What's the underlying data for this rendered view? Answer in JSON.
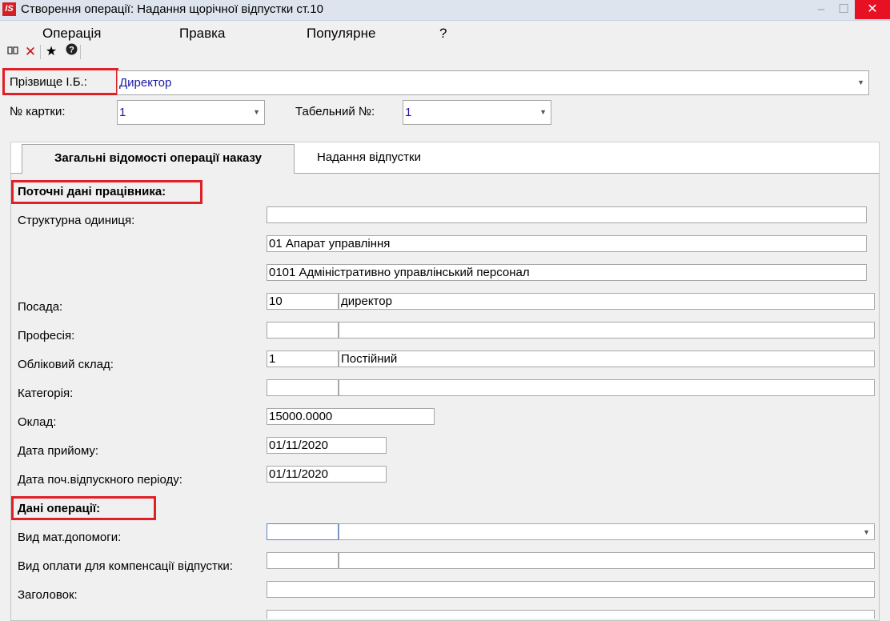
{
  "window": {
    "title": "Створення операції: Надання щорічної відпустки ст.10",
    "app_icon": "IS",
    "minimize": "–",
    "maximize": "☐",
    "close": "✕"
  },
  "menu": [
    "Операція",
    "Правка",
    "Популярне",
    "?"
  ],
  "toolbar": {
    "icons": [
      "book-icon",
      "delete-icon",
      "star-icon",
      "help-icon"
    ],
    "glyphs": [
      "🕮",
      "✕",
      "★",
      "❓"
    ]
  },
  "header": {
    "surname_label": "Прізвище І.Б.:",
    "surname_value": "Директор",
    "card_label": "№ картки:",
    "card_value": "1",
    "tab_number_label": "Табельний №:",
    "tab_number_value": "1"
  },
  "tabs": [
    {
      "label": "Загальні відомості операції наказу",
      "active": true
    },
    {
      "label": "Надання відпустки",
      "active": false
    }
  ],
  "current_data": {
    "section_title": "Поточні дані працівника:",
    "struct_unit_label": "Структурна одиниця:",
    "struct_unit_lines": [
      "",
      "01 Апарат управління",
      "0101 Адміністративно управлінський персонал"
    ],
    "position_label": "Посада:",
    "position_code": "10",
    "position_name": "директор",
    "profession_label": "Професія:",
    "profession_code": "",
    "profession_name": "",
    "staff_label": "Обліковий склад:",
    "staff_code": "1",
    "staff_name": "Постійний",
    "category_label": "Категорія:",
    "category_code": "",
    "category_name": "",
    "salary_label": "Оклад:",
    "salary_value": "15000.0000",
    "hire_date_label": "Дата прийому:",
    "hire_date_value": "01/11/2020",
    "vac_period_label": "Дата поч.відпускного періоду:",
    "vac_period_value": "01/11/2020"
  },
  "operation_data": {
    "section_title": "Дані операції:",
    "aid_type_label": "Вид мат.допомоги:",
    "aid_type_code": "",
    "aid_type_name": "",
    "comp_pay_label": "Вид оплати для компенсації відпустки:",
    "comp_pay_code": "",
    "comp_pay_name": "",
    "heading_label": "Заголовок:",
    "heading_value": ""
  },
  "colors": {
    "accent_red": "#e01f26",
    "link_blue": "#1a1aa6",
    "titlebar": "#dde4ee"
  }
}
